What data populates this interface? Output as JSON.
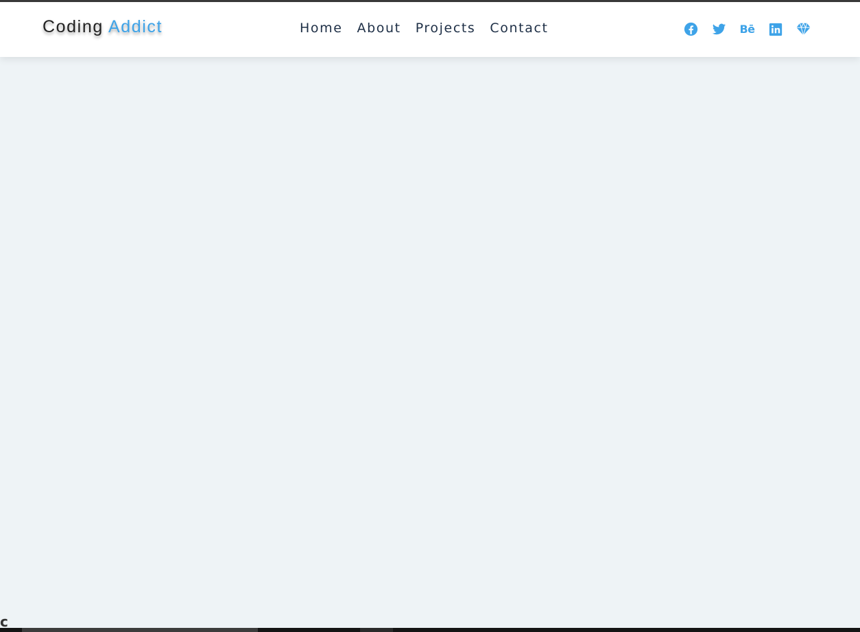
{
  "logo": {
    "part1": "Coding",
    "part2": "Addict"
  },
  "nav": {
    "items": [
      {
        "label": "Home"
      },
      {
        "label": "About"
      },
      {
        "label": "Projects"
      },
      {
        "label": "Contact"
      }
    ]
  },
  "socials": {
    "behance_text": "Bē",
    "icons": [
      "facebook-icon",
      "twitter-icon",
      "behance-icon",
      "linkedin-icon",
      "sketch-icon"
    ]
  },
  "colors": {
    "accent": "#3ea3e8",
    "nav_text": "#1e2f46",
    "page_background": "#eef3f6",
    "navbar_background": "#ffffff"
  },
  "corner_glyph": "c"
}
